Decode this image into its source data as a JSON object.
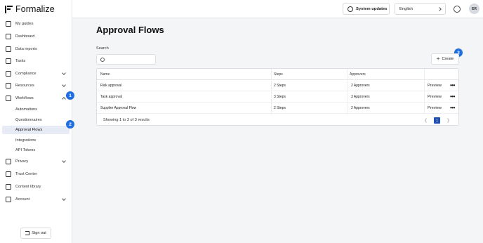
{
  "app": {
    "logo_text": "Formalize"
  },
  "sidebar": {
    "items": [
      {
        "label": "My guides",
        "icon": "cursor-icon"
      },
      {
        "label": "Dashboard",
        "icon": "home-icon"
      },
      {
        "label": "Data reports",
        "icon": "document-icon"
      },
      {
        "label": "Tasks",
        "icon": "checklist-icon"
      },
      {
        "label": "Compliance",
        "icon": "folder-icon"
      },
      {
        "label": "Resources",
        "icon": "grid-icon"
      },
      {
        "label": "Workflows",
        "icon": "sparkle-icon"
      },
      {
        "label": "Privacy",
        "icon": "users-icon"
      },
      {
        "label": "Trust Center",
        "icon": "shield-icon"
      },
      {
        "label": "Content library",
        "icon": "book-icon"
      },
      {
        "label": "Account",
        "icon": "user-settings-icon"
      }
    ],
    "workflow_sub": [
      "Automations",
      "Questionnaires",
      "Approval Flows",
      "Integrations",
      "API Tokens"
    ],
    "signout_label": "Sign out"
  },
  "topbar": {
    "system_updates_label": "System updates",
    "language_value": "English",
    "avatar_initials": "ER"
  },
  "main": {
    "title": "Approval Flows",
    "search_label": "Search",
    "search_value": "",
    "create_label": "Create",
    "columns": [
      "Name",
      "Steps",
      "Approvers"
    ],
    "rows": [
      {
        "name": "Risk approval",
        "steps": "2 Steps",
        "approvers": "2 Approvers",
        "action": "Preview"
      },
      {
        "name": "Task approval",
        "steps": "3 Steps",
        "approvers": "3 Approvers",
        "action": "Preview"
      },
      {
        "name": "Supplier Approval Flow",
        "steps": "2 Steps",
        "approvers": "2 Approvers",
        "action": "Preview"
      }
    ],
    "summary": "Showing 1 to 3 of 3 results",
    "current_page": "1"
  },
  "badges": [
    "1",
    "2",
    "3"
  ],
  "colors": {
    "accent": "#1f6fe0",
    "active_bg": "#e7ebf5",
    "pager": "#1f4fb3"
  }
}
